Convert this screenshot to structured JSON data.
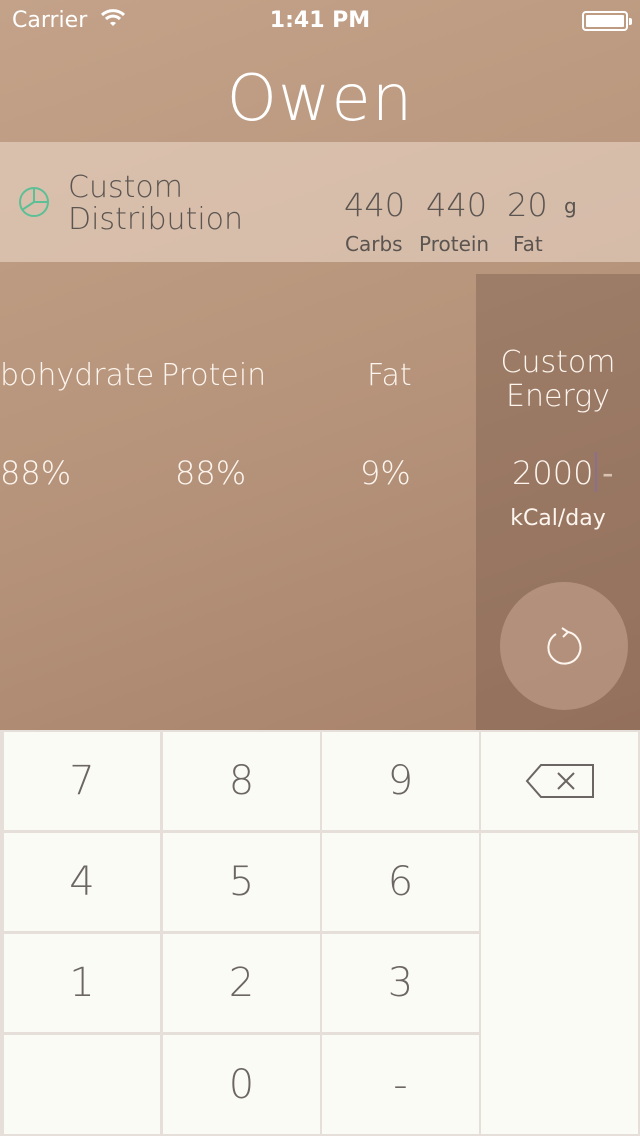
{
  "status": {
    "carrier": "Carrier",
    "time": "1:41 PM"
  },
  "title": "Owen",
  "distribution": {
    "label_line1": "Custom",
    "label_line2": "Distribution",
    "carbs_value": "440",
    "protein_value": "440",
    "fat_value": "20",
    "unit": "g",
    "carbs_label": "Carbs",
    "protein_label": "Protein",
    "fat_label": "Fat"
  },
  "macros": {
    "carb_head": "bohydrate",
    "protein_head": "Protein",
    "fat_head": "Fat",
    "carb_val": "88%",
    "protein_val": "88%",
    "fat_val": "9%"
  },
  "energy": {
    "head_line1": "Custom",
    "head_line2": "Energy",
    "value": "2000",
    "dash": "-",
    "unit": "kCal/day"
  },
  "keypad": {
    "k7": "7",
    "k8": "8",
    "k9": "9",
    "k4": "4",
    "k5": "5",
    "k6": "6",
    "k1": "1",
    "k2": "2",
    "k3": "3",
    "k0": "0",
    "kminus": "-"
  },
  "colors": {
    "accent": "#5dbf95"
  },
  "icons": [
    "wifi-icon",
    "battery-icon",
    "pie-chart-icon",
    "reset-icon",
    "backspace-icon"
  ]
}
